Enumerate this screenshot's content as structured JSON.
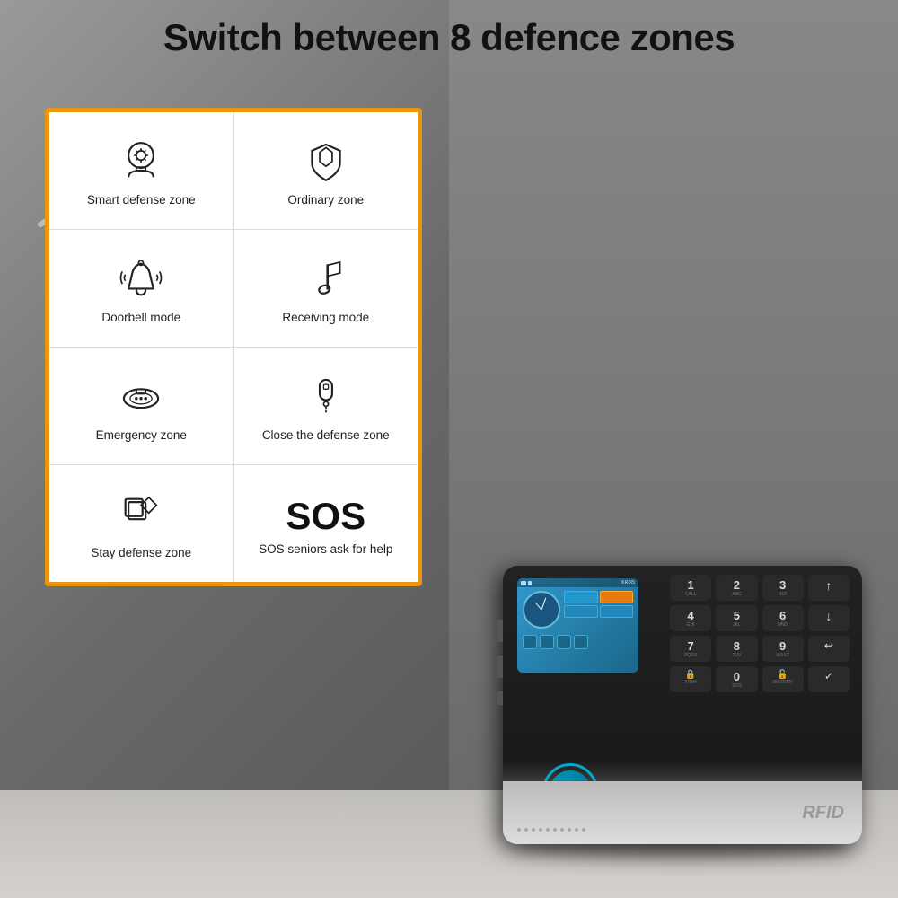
{
  "title": "Switch between 8 defence zones",
  "card": {
    "border_color": "#e8960a",
    "cells": [
      {
        "id": "smart-defense",
        "icon": "brain-gear",
        "label": "Smart defense zone"
      },
      {
        "id": "ordinary",
        "icon": "shield",
        "label": "Ordinary zone"
      },
      {
        "id": "doorbell",
        "icon": "bell",
        "label": "Doorbell mode"
      },
      {
        "id": "receiving",
        "icon": "music-note",
        "label": "Receiving mode"
      },
      {
        "id": "emergency",
        "icon": "smoke-detector",
        "label": "Emergency zone"
      },
      {
        "id": "close-defense",
        "icon": "key-fob",
        "label": "Close the defense zone"
      },
      {
        "id": "stay-defense",
        "icon": "layers",
        "label": "Stay defense zone"
      },
      {
        "id": "sos",
        "icon": "sos-text",
        "label": "SOS seniors ask for help"
      }
    ]
  },
  "device": {
    "rfid_label": "RFID",
    "keypad": {
      "keys": [
        {
          "num": "1",
          "letters": "CALL"
        },
        {
          "num": "2",
          "letters": "ABC"
        },
        {
          "num": "3",
          "letters": "DEF"
        },
        {
          "num": "↑",
          "letters": ""
        },
        {
          "num": "4",
          "letters": "GHI"
        },
        {
          "num": "5",
          "letters": "JKL"
        },
        {
          "num": "6",
          "letters": "MNO"
        },
        {
          "num": "↓",
          "letters": ""
        },
        {
          "num": "7",
          "letters": "PQRS"
        },
        {
          "num": "8",
          "letters": "TUV"
        },
        {
          "num": "9",
          "letters": "WXYZ"
        },
        {
          "num": "↩",
          "letters": ""
        },
        {
          "num": "🔒",
          "letters": "ARM#"
        },
        {
          "num": "0",
          "letters": "SOS"
        },
        {
          "num": "🔓",
          "letters": "DISARM#"
        },
        {
          "num": "✓",
          "letters": ""
        }
      ]
    }
  },
  "wifi": {
    "color": "#b0b0b0"
  }
}
